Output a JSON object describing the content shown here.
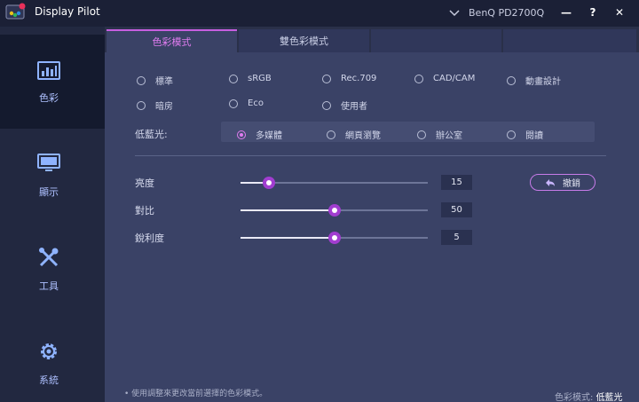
{
  "app": {
    "title": "Display Pilot",
    "monitor": "BenQ PD2700Q",
    "minimize": "—",
    "help": "?",
    "close": "✕"
  },
  "sidebar": {
    "items": [
      {
        "label": "色彩",
        "icon": "color-chart-icon",
        "active": true
      },
      {
        "label": "顯示",
        "icon": "monitor-icon",
        "active": false
      },
      {
        "label": "工具",
        "icon": "tools-icon",
        "active": false
      },
      {
        "label": "系統",
        "icon": "gear-icon",
        "active": false
      }
    ]
  },
  "tabs": [
    {
      "label": "色彩模式",
      "active": true
    },
    {
      "label": "雙色彩模式",
      "active": false
    },
    {
      "label": "",
      "active": false
    },
    {
      "label": "",
      "active": false
    }
  ],
  "color_modes": {
    "options": [
      "標準",
      "sRGB",
      "Rec.709",
      "CAD/CAM",
      "動畫設計",
      "暗房",
      "Eco",
      "使用者"
    ]
  },
  "low_blue_light": {
    "label": "低藍光:",
    "options": [
      "多媒體",
      "網頁瀏覽",
      "辦公室",
      "閱讀"
    ],
    "selected": "多媒體"
  },
  "sliders": [
    {
      "label": "亮度",
      "value": "15",
      "percent": 15
    },
    {
      "label": "對比",
      "value": "50",
      "percent": 50
    },
    {
      "label": "銳利度",
      "value": "5",
      "percent": 50
    }
  ],
  "undo_label": "撤銷",
  "hint": "• 使用調整來更改當前選擇的色彩模式。",
  "status": {
    "label": "色彩模式:",
    "value": "低藍光"
  },
  "colors": {
    "accent": "#c75ee0",
    "thumb": "#a13dd0",
    "panel": "#3a4266",
    "sidebar": "#222840"
  }
}
